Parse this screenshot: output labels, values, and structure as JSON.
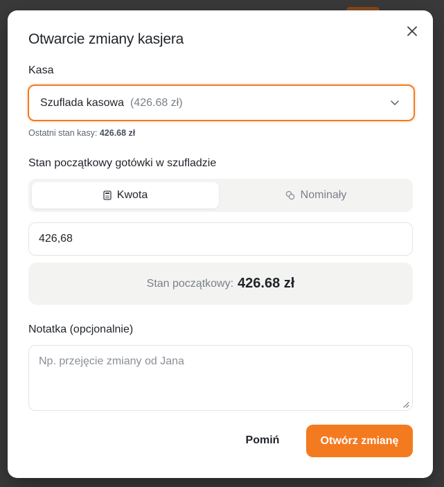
{
  "modal": {
    "title": "Otwarcie zmiany kasjera",
    "close_icon": "close-icon"
  },
  "register": {
    "label": "Kasa",
    "selected_name": "Szuflada kasowa",
    "selected_amount": "(426.68 zł)",
    "last_state_label": "Ostatni stan kasy:",
    "last_state_value": "426.68 zł"
  },
  "opening_cash": {
    "label": "Stan początkowy gotówki w szufladzie",
    "tabs": [
      {
        "label": "Kwota",
        "icon": "calculator-icon",
        "active": true
      },
      {
        "label": "Nominały",
        "icon": "coins-icon",
        "active": false
      }
    ],
    "amount_value": "426,68",
    "summary_label": "Stan początkowy:",
    "summary_value": "426.68 zł"
  },
  "note": {
    "label": "Notatka (opcjonalnie)",
    "placeholder": "Np. przejęcie zmiany od Jana"
  },
  "actions": {
    "skip_label": "Pomiń",
    "submit_label": "Otwórz zmianę"
  },
  "colors": {
    "accent": "#f47a20",
    "surface": "#f3f3f2"
  }
}
